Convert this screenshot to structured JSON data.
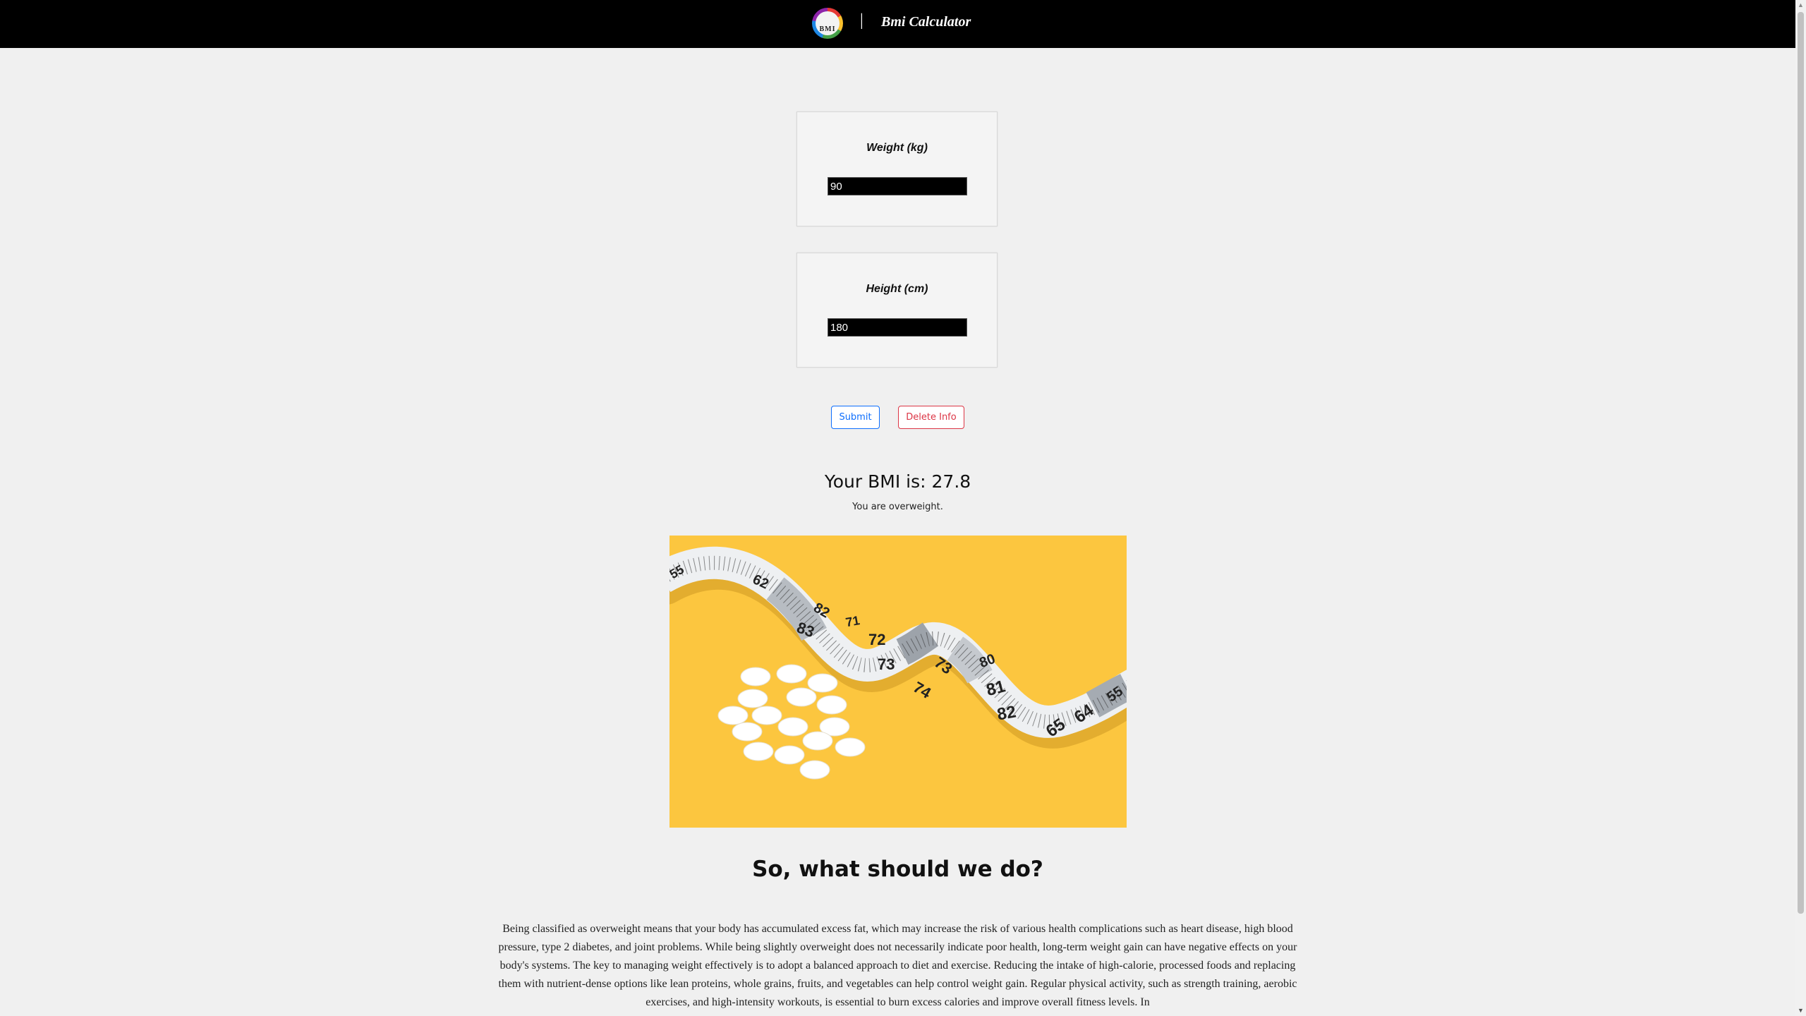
{
  "header": {
    "logo_text": "BMI",
    "separator": "|",
    "title": "Bmi Calculator"
  },
  "form": {
    "weight": {
      "label": "Weight (kg)",
      "value": "90"
    },
    "height": {
      "label": "Height (cm)",
      "value": "180"
    },
    "submit_label": "Submit",
    "delete_label": "Delete Info"
  },
  "result": {
    "bmi_text": "Your BMI is: 27.8",
    "status_text": "You are overweight."
  },
  "image": {
    "tape_numbers": [
      "55",
      "62",
      "82",
      "83",
      "71",
      "72",
      "73",
      "73",
      "74",
      "80",
      "81",
      "82",
      "64",
      "65",
      "55"
    ]
  },
  "advice": {
    "heading": "So, what should we do?",
    "paragraph": "Being classified as overweight means that your body has accumulated excess fat, which may increase the risk of various health complications such as heart disease, high blood pressure, type 2 diabetes, and joint problems. While being slightly overweight does not necessarily indicate poor health, long-term weight gain can have negative effects on your body's systems. The key to managing weight effectively is to adopt a balanced approach to diet and exercise. Reducing the intake of high-calorie, processed foods and replacing them with nutrient-dense options like lean proteins, whole grains, fruits, and vegetables can help control weight gain. Regular physical activity, such as strength training, aerobic exercises, and high-intensity workouts, is essential to burn excess calories and improve overall fitness levels. In"
  },
  "colors": {
    "header_bg": "#000000",
    "page_bg": "#f0f0f0",
    "submit": "#0d6efd",
    "delete": "#dc3545",
    "image_bg": "#fcc63f"
  }
}
